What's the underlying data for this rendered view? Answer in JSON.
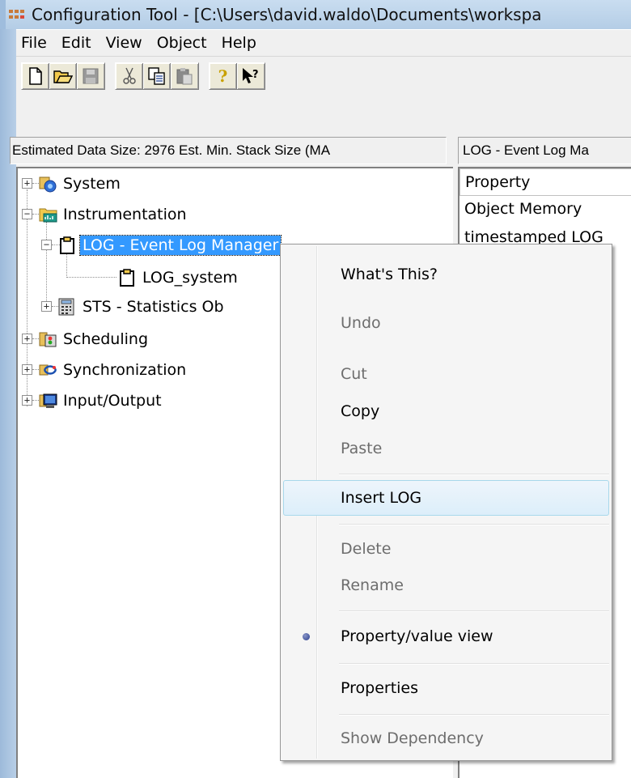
{
  "window": {
    "title": "Configuration Tool - [C:\\Users\\david.waldo\\Documents\\workspa"
  },
  "menubar": {
    "items": [
      "File",
      "Edit",
      "View",
      "Object",
      "Help"
    ]
  },
  "toolbar": {
    "buttons": [
      "new-icon",
      "open-icon",
      "save-icon",
      "cut-icon",
      "copy-icon",
      "paste-icon",
      "help-icon",
      "whats-this-icon"
    ]
  },
  "status": {
    "left": "Estimated Data Size: 2976   Est. Min. Stack Size (MA",
    "right": "LOG - Event Log Ma"
  },
  "tree": {
    "items": [
      {
        "label": "System",
        "icon": "system-icon",
        "expander": "+"
      },
      {
        "label": "Instrumentation",
        "icon": "instrumentation-icon",
        "expander": "−"
      },
      {
        "label": "LOG - Event Log Manager",
        "icon": "clipboard-icon",
        "expander": "−"
      },
      {
        "label": "LOG_system",
        "icon": "clipboard-icon"
      },
      {
        "label": "STS - Statistics Ob",
        "icon": "calculator-icon",
        "expander": "+"
      },
      {
        "label": "Scheduling",
        "icon": "scheduling-icon",
        "expander": "+"
      },
      {
        "label": "Synchronization",
        "icon": "synchronization-icon",
        "expander": "+"
      },
      {
        "label": "Input/Output",
        "icon": "monitor-icon",
        "expander": "+"
      }
    ]
  },
  "properties": {
    "header": "Property",
    "rows": [
      "Object Memory",
      "timestamped LOG"
    ]
  },
  "context_menu": {
    "items": [
      {
        "label": "What's This?",
        "disabled": false
      },
      {
        "label": "Undo",
        "disabled": true
      },
      {
        "label": "Cut",
        "disabled": true
      },
      {
        "label": "Copy",
        "disabled": false
      },
      {
        "label": "Paste",
        "disabled": true
      },
      {
        "label": "Insert LOG",
        "disabled": false,
        "hover": true
      },
      {
        "label": "Delete",
        "disabled": true
      },
      {
        "label": "Rename",
        "disabled": true
      },
      {
        "label": "Property/value view",
        "disabled": false,
        "checked": true
      },
      {
        "label": "Properties",
        "disabled": false
      },
      {
        "label": "Show Dependency",
        "disabled": true
      }
    ]
  },
  "colors": {
    "selection": "#3399ff",
    "menu_hover_border": "#a8d8eb",
    "disabled_text": "#6d6d6d"
  }
}
